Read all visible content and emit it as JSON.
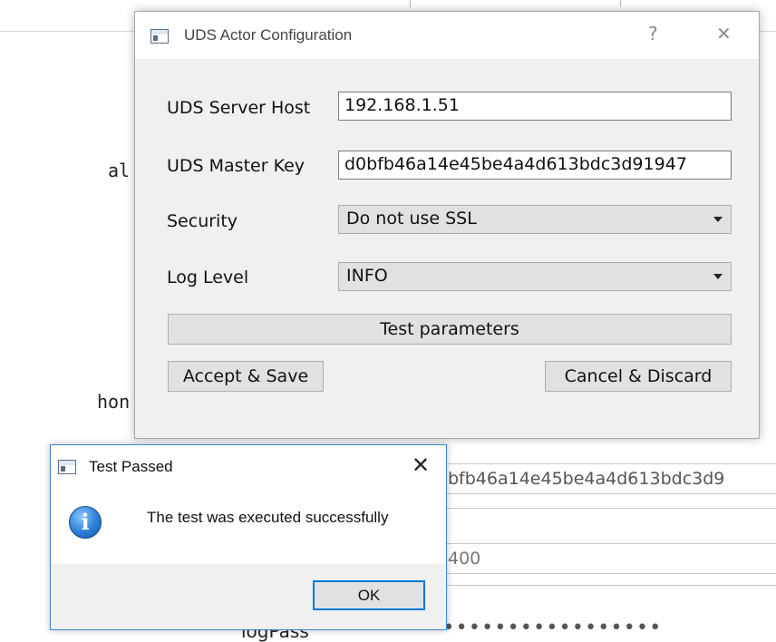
{
  "background_window": {
    "label_fragment_1": "al",
    "label_fragment_2": "hon",
    "label_fragment_3": "logPass",
    "master_key_fragment": "bfb46a14e45be4a4d613bdc3d9",
    "port_fragment": "400",
    "password_mask": "••••••••••••••••••"
  },
  "config_dialog": {
    "title": "UDS Actor Configuration",
    "help_glyph": "?",
    "close_glyph": "✕",
    "fields": {
      "server_host_label": "UDS Server Host",
      "server_host_value": "192.168.1.51",
      "master_key_label": "UDS Master Key",
      "master_key_value": "d0bfb46a14e45be4a4d613bdc3d91947",
      "security_label": "Security",
      "security_value": "Do not use SSL",
      "log_level_label": "Log Level",
      "log_level_value": "INFO"
    },
    "buttons": {
      "test": "Test parameters",
      "accept": "Accept & Save",
      "cancel": "Cancel & Discard"
    }
  },
  "message_box": {
    "title": "Test Passed",
    "close_glyph": "✕",
    "icon_glyph": "i",
    "message": "The test was executed successfully",
    "ok_label": "OK"
  },
  "colors": {
    "dialog_bg": "#f0f0f0",
    "button_bg": "#e1e1e1",
    "focus_blue": "#0078d7",
    "info_blue": "#2c7ed6"
  }
}
